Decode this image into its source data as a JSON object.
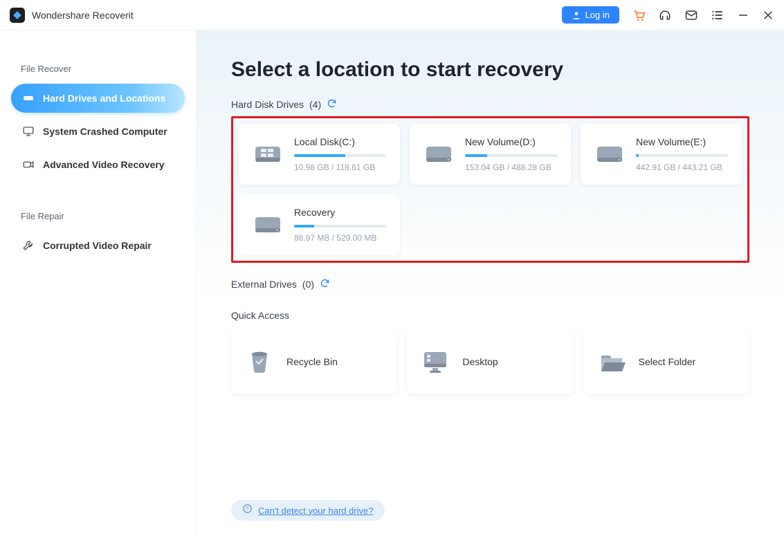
{
  "app": {
    "title": "Wondershare Recoverit"
  },
  "titlebar": {
    "login_label": "Log in"
  },
  "sidebar": {
    "section1_label": "File Recover",
    "section2_label": "File Repair",
    "items": [
      {
        "label": "Hard Drives and Locations"
      },
      {
        "label": "System Crashed Computer"
      },
      {
        "label": "Advanced Video Recovery"
      },
      {
        "label": "Corrupted Video Repair"
      }
    ]
  },
  "main": {
    "title": "Select a location to start recovery",
    "hard_drives_label": "Hard Disk Drives",
    "hard_drives_count": "(4)",
    "drives": [
      {
        "name": "Local Disk(C:)",
        "sub": "10.98 GB / 118.61 GB",
        "pct": 56,
        "type": "windows"
      },
      {
        "name": "New Volume(D:)",
        "sub": "153.04 GB / 488.28 GB",
        "pct": 24,
        "type": "hdd"
      },
      {
        "name": "New Volume(E:)",
        "sub": "442.91 GB / 443.21 GB",
        "pct": 3,
        "type": "hdd"
      },
      {
        "name": "Recovery",
        "sub": "88.97 MB / 529.00 MB",
        "pct": 22,
        "type": "hdd"
      }
    ],
    "external_label": "External Drives",
    "external_count": "(0)",
    "quick_access_label": "Quick Access",
    "quick": [
      {
        "label": "Recycle Bin",
        "icon": "recycle"
      },
      {
        "label": "Desktop",
        "icon": "desktop"
      },
      {
        "label": "Select Folder",
        "icon": "folder"
      }
    ],
    "help_link": "Can't detect your hard drive?"
  }
}
